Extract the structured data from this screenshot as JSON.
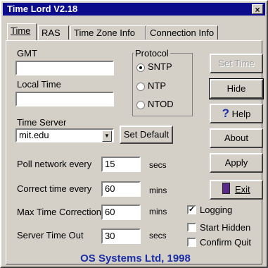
{
  "window": {
    "title": "Time Lord V2.18",
    "close": "×"
  },
  "tabs": [
    {
      "label": "Time"
    },
    {
      "label": "RAS"
    },
    {
      "label": "Time Zone Info"
    },
    {
      "label": "Connection Info"
    }
  ],
  "time": {
    "gmt_label": "GMT",
    "gmt_value": "",
    "local_label": "Local Time",
    "local_value": "",
    "server_label": "Time Server",
    "server_value": "mit.edu",
    "set_default": "Set Default"
  },
  "protocol": {
    "title": "Protocol",
    "options": [
      {
        "label": "SNTP",
        "selected": true
      },
      {
        "label": "NTP",
        "selected": false
      },
      {
        "label": "NTOD",
        "selected": false
      }
    ]
  },
  "settings": [
    {
      "label": "Poll network every",
      "value": "15",
      "unit": "secs"
    },
    {
      "label": "Correct time every",
      "value": "60",
      "unit": "mins"
    },
    {
      "label": "Max Time Correction",
      "value": "60",
      "unit": "mins"
    },
    {
      "label": "Server Time Out",
      "value": "30",
      "unit": "secs"
    }
  ],
  "buttons": {
    "set_time": "Set Time",
    "hide": "Hide",
    "help": "Help",
    "about": "About",
    "apply": "Apply",
    "exit": "Exit"
  },
  "checkboxes": [
    {
      "label": "Logging",
      "checked": true
    },
    {
      "label": "Start Hidden",
      "checked": false
    },
    {
      "label": "Confirm Quit",
      "checked": false
    }
  ],
  "footer": "OS Systems Ltd, 1998"
}
